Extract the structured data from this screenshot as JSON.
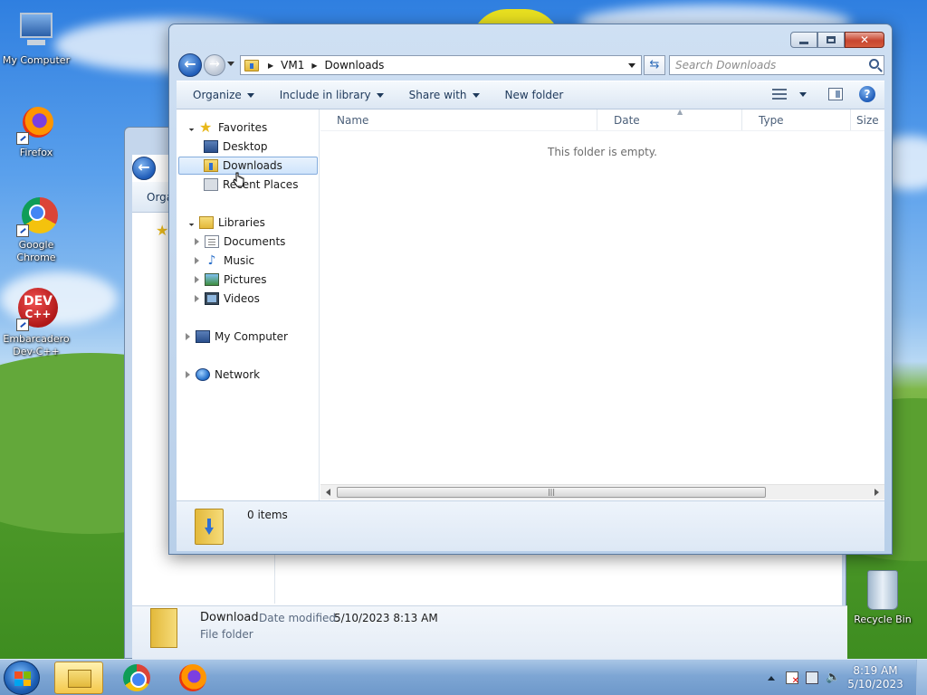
{
  "desktop": {
    "icons": [
      {
        "label": "My Computer",
        "icon": "computer-icon"
      },
      {
        "label": "Firefox",
        "icon": "firefox-icon"
      },
      {
        "label": "Google Chrome",
        "icon": "chrome-icon"
      },
      {
        "label": "Embarcadero Dev-C++",
        "icon": "devcpp-icon",
        "badge": "DEV\nC++"
      },
      {
        "label": "Recycle Bin",
        "icon": "recycle-bin-icon"
      }
    ],
    "devcpp_text": "DEV",
    "devcpp_sub": "C++"
  },
  "window": {
    "address": {
      "root": "VM1",
      "current": "Downloads"
    },
    "search_placeholder": "Search Downloads",
    "toolbar": {
      "organize": "Organize",
      "include_in_library": "Include in library",
      "share_with": "Share with",
      "new_folder": "New folder"
    },
    "nav": {
      "favorites": "Favorites",
      "desktop": "Desktop",
      "downloads": "Downloads",
      "recent_places": "Recent Places",
      "libraries": "Libraries",
      "documents": "Documents",
      "music": "Music",
      "pictures": "Pictures",
      "videos": "Videos",
      "my_computer": "My Computer",
      "network": "Network"
    },
    "columns": {
      "name": "Name",
      "date": "Date",
      "type": "Type",
      "size": "Size"
    },
    "empty_message": "This folder is empty.",
    "status": {
      "items": "0 items"
    }
  },
  "background_window": {
    "toolbar_partial": "Orga",
    "details": {
      "name": "Download",
      "date_label": "Date modified:",
      "date_value": "5/10/2023 8:13 AM",
      "type": "File folder"
    }
  },
  "taskbar": {
    "time": "8:19 AM",
    "date": "5/10/2023"
  },
  "colors": {
    "accent": "#1f5cb8",
    "close_button": "#c84630",
    "taskbar": "#7ea6d4",
    "selection": "#cfe4fb"
  }
}
